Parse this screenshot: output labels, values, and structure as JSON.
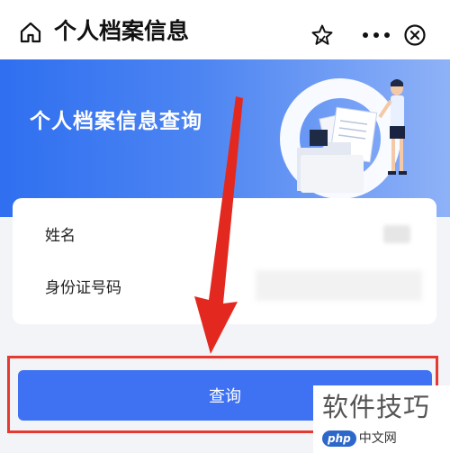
{
  "header": {
    "title": "个人档案信息",
    "icons": [
      "home-icon",
      "star-icon",
      "more-icon",
      "close-icon"
    ]
  },
  "banner": {
    "title": "个人档案信息查询"
  },
  "form": {
    "name_label": "姓名",
    "id_label": "身份证号码",
    "name_value": "",
    "id_value": ""
  },
  "actions": {
    "query_label": "查询"
  },
  "watermark": {
    "text": "软件技巧",
    "logo": "php",
    "site": "中文网"
  },
  "colors": {
    "accent": "#3f72f2",
    "highlight": "#e63a31",
    "banner_start": "#2f6ff0",
    "banner_end": "#8fb2f7"
  }
}
